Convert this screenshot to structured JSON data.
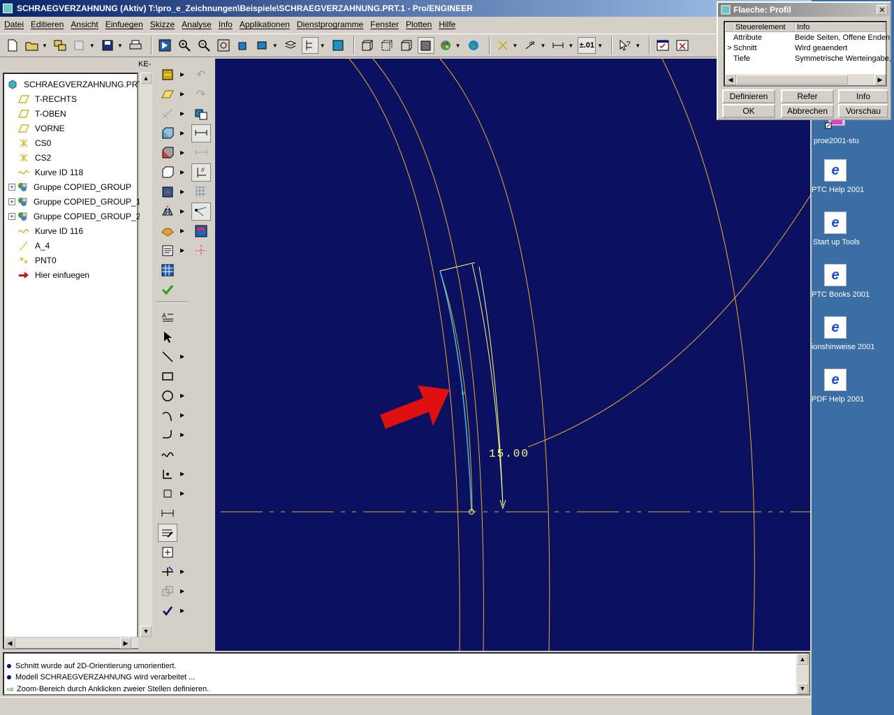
{
  "window": {
    "title": "SCHRAEGVERZAHNUNG (Aktiv)  T:\\pro_e_Zeichnungen\\Beispiele\\SCHRAEGVERZAHNUNG.PRT.1 - Pro/ENGINEER"
  },
  "menu": [
    "Datei",
    "Editieren",
    "Ansicht",
    "Einfuegen",
    "Skizze",
    "Analyse",
    "Info",
    "Applikationen",
    "Dienstprogramme",
    "Fenster",
    "Plotten",
    "Hilfe"
  ],
  "toolbar": {
    "precision_label": "±.01"
  },
  "tree": {
    "tab_label": "KE-",
    "root": "SCHRAEGVERZAHNUNG.PRT",
    "items": [
      {
        "label": "T-RECHTS",
        "icon": "datum-plane-icon",
        "expand": ""
      },
      {
        "label": "T-OBEN",
        "icon": "datum-plane-icon",
        "expand": ""
      },
      {
        "label": "VORNE",
        "icon": "datum-plane-icon",
        "expand": ""
      },
      {
        "label": "CS0",
        "icon": "coordinate-system-icon",
        "expand": ""
      },
      {
        "label": "CS2",
        "icon": "coordinate-system-icon",
        "expand": ""
      },
      {
        "label": "Kurve ID 118",
        "icon": "curve-icon",
        "expand": ""
      },
      {
        "label": "Gruppe COPIED_GROUP",
        "icon": "group-icon",
        "expand": "+"
      },
      {
        "label": "Gruppe COPIED_GROUP_1",
        "icon": "group-icon",
        "expand": "+"
      },
      {
        "label": "Gruppe COPIED_GROUP_2",
        "icon": "group-icon",
        "expand": "+"
      },
      {
        "label": "Kurve ID 116",
        "icon": "curve-icon",
        "expand": ""
      },
      {
        "label": "A_4",
        "icon": "axis-icon",
        "expand": ""
      },
      {
        "label": "PNT0",
        "icon": "datum-point-icon",
        "expand": ""
      },
      {
        "label": "Hier einfuegen",
        "icon": "insert-arrow-icon",
        "expand": ""
      }
    ]
  },
  "viewport": {
    "dimension_text": "15.00",
    "background_color": "#0b1060",
    "geometry_color": "#e8b030",
    "sketch_color": "#40c0e0",
    "annotation_color": "#ffff80",
    "arrow_color": "#e01010"
  },
  "status": {
    "messages": [
      {
        "text": "Schnitt wurde auf 2D-Orientierung umorientiert.",
        "type": "info"
      },
      {
        "text": "Modell SCHRAEGVERZAHNUNG wird verarbeitet ...",
        "type": "info"
      },
      {
        "text": "Zoom-Bereich durch Anklicken zweier Stellen definieren.",
        "type": "prompt"
      }
    ]
  },
  "desktop": {
    "icons": [
      {
        "label": "proe2001-stu"
      },
      {
        "label": "PTC Help 2001"
      },
      {
        "label": "Start up Tools"
      },
      {
        "label": "PTC Books 2001"
      },
      {
        "label": "ionshinweise 2001"
      },
      {
        "label": "PDF Help 2001"
      }
    ]
  },
  "dialog": {
    "title": "Flaeche: Profil",
    "col_element": "Steuerelement",
    "col_info": "Info",
    "rows": [
      {
        "marker": "",
        "element": "Attribute",
        "info": "Beide Seiten, Offene Enden"
      },
      {
        "marker": ">",
        "element": "Schnitt",
        "info": "Wird geaendert"
      },
      {
        "marker": "",
        "element": "Tiefe",
        "info": "Symmetrische Werteingabe,"
      }
    ],
    "buttons": {
      "define": "Definieren",
      "refs": "Refer",
      "info": "Info",
      "ok": "OK",
      "cancel": "Abbrechen",
      "preview": "Vorschau"
    }
  }
}
